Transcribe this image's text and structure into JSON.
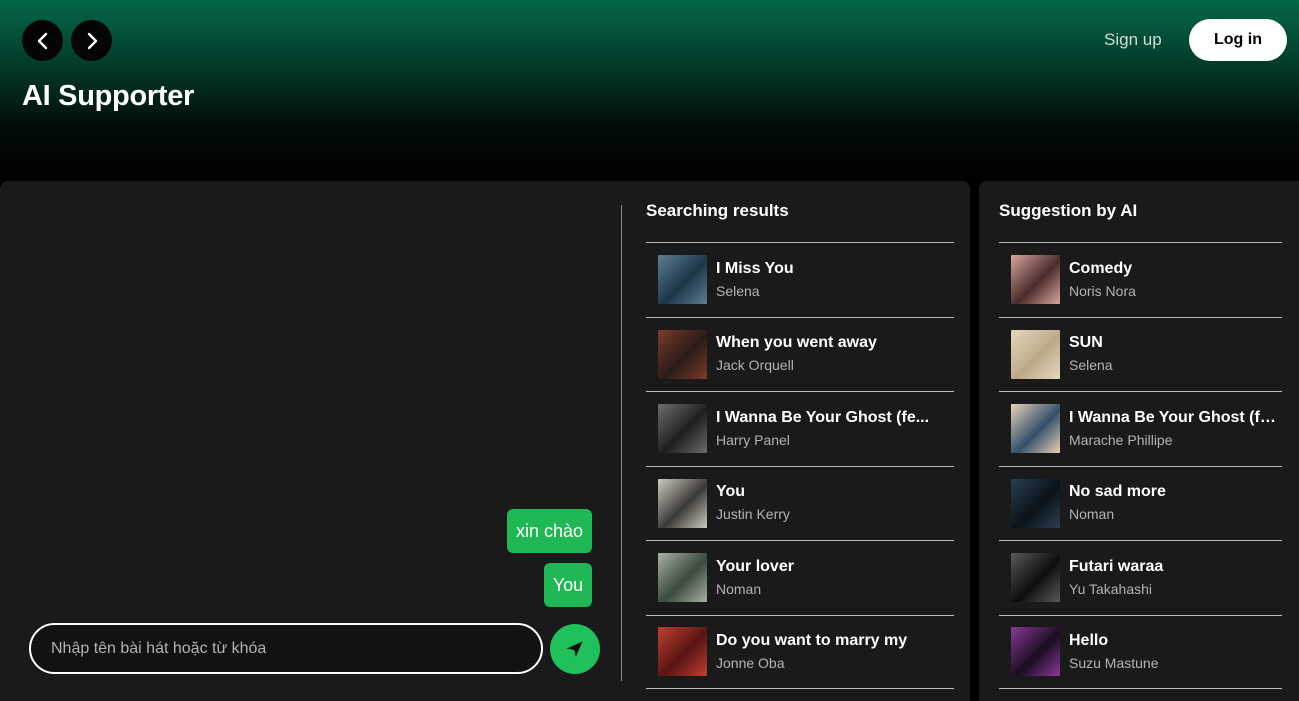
{
  "header": {
    "title": "AI Supporter",
    "signup_label": "Sign up",
    "login_label": "Log in"
  },
  "chat": {
    "messages": [
      "xin chào",
      "You"
    ],
    "input_placeholder": "Nhập tên bài hát hoặc từ khóa",
    "input_value": ""
  },
  "search": {
    "title": "Searching results",
    "items": [
      {
        "title": "I Miss You",
        "artist": "Selena",
        "thumb_colors": [
          "#1c3648",
          "#5f7f93"
        ]
      },
      {
        "title": "When you went away",
        "artist": "Jack Orquell",
        "thumb_colors": [
          "#2a1b17",
          "#7a3b2c"
        ]
      },
      {
        "title": "I Wanna Be Your Ghost (fe...",
        "artist": "Harry Panel",
        "thumb_colors": [
          "#1e1e1e",
          "#6e6e6e"
        ]
      },
      {
        "title": "You",
        "artist": "Justin Kerry",
        "thumb_colors": [
          "#3b3a36",
          "#cfcac0"
        ]
      },
      {
        "title": "Your lover",
        "artist": "Noman",
        "thumb_colors": [
          "#3a4a3e",
          "#a7b2a2"
        ]
      },
      {
        "title": "Do you want to marry my",
        "artist": "Jonne Oba",
        "thumb_colors": [
          "#5a1414",
          "#c04030"
        ]
      }
    ]
  },
  "suggestion": {
    "title": "Suggestion by AI",
    "items": [
      {
        "title": "Comedy",
        "artist": "Noris Nora",
        "thumb_colors": [
          "#4a2b2a",
          "#d9a8a0"
        ]
      },
      {
        "title": "SUN",
        "artist": "Selena",
        "thumb_colors": [
          "#bca98a",
          "#e6d8bc"
        ]
      },
      {
        "title": "I Wanna Be Your Ghost (fe...",
        "artist": "Marache Phillipe",
        "thumb_colors": [
          "#34506b",
          "#e8d1b8"
        ]
      },
      {
        "title": "No sad more",
        "artist": "Noman",
        "thumb_colors": [
          "#0b1218",
          "#2a3f52"
        ]
      },
      {
        "title": "Futari waraa",
        "artist": "Yu Takahashi",
        "thumb_colors": [
          "#0d0d0d",
          "#5a5a5a"
        ]
      },
      {
        "title": "Hello",
        "artist": "Suzu Mastune",
        "thumb_colors": [
          "#1a0d1f",
          "#8a3a9a"
        ]
      }
    ]
  },
  "colors": {
    "accent": "#1fb855",
    "header_top": "#04684a",
    "panel": "#1a1a1a"
  },
  "icons": {
    "back": "chevron-left-icon",
    "forward": "chevron-right-icon",
    "send": "send-icon"
  }
}
